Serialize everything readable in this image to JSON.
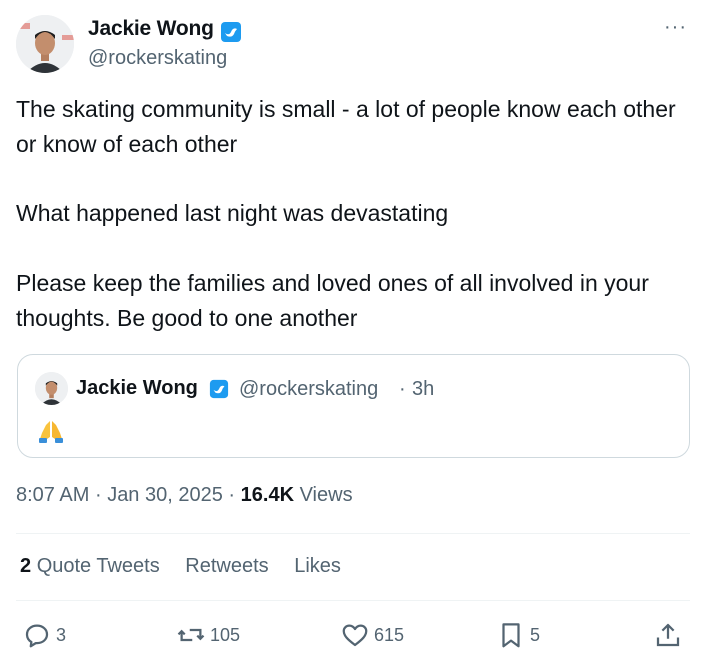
{
  "author": {
    "name": "Jackie Wong",
    "handle": "@rockerskating",
    "verified_icon": "verified-badge-icon"
  },
  "tweet": {
    "paragraphs": [
      "The skating community is small - a lot of people know each other or know of each other",
      "What happened last night was devastating",
      "Please keep the families and loved ones of all involved in your thoughts. Be good to one another"
    ]
  },
  "quote": {
    "name": "Jackie Wong",
    "handle": "@rockerskating",
    "separator": "·",
    "time": "3h",
    "content_icon": "folded-hands-emoji"
  },
  "meta": {
    "time": "8:07 AM",
    "sep1": "·",
    "date": "Jan 30, 2025",
    "sep2": "·",
    "views_count": "16.4K",
    "views_label": "Views"
  },
  "stats": {
    "quote_tweets_count": "2",
    "quote_tweets_label": "Quote Tweets",
    "retweets_label": "Retweets",
    "likes_label": "Likes"
  },
  "actions": {
    "reply_count": "3",
    "retweet_count": "105",
    "like_count": "615",
    "bookmark_count": "5"
  },
  "more_label": "···",
  "colors": {
    "accent": "#1d9bf0",
    "text": "#0f1419",
    "secondary": "#536471",
    "border": "#cfd9de"
  }
}
